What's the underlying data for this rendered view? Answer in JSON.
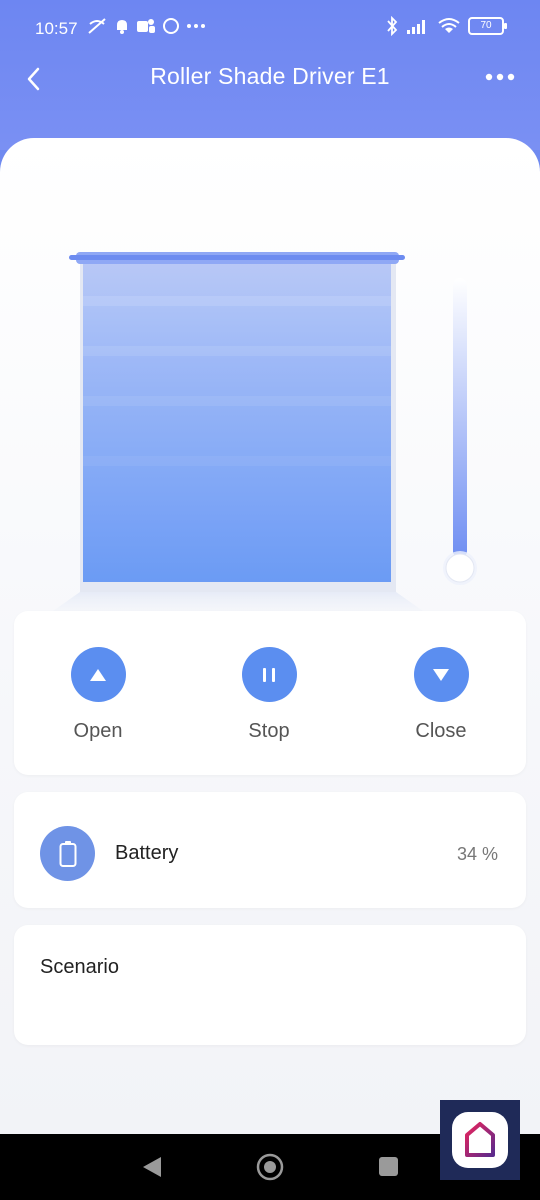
{
  "status": {
    "time": "10:57",
    "battery": "70"
  },
  "app": {
    "title": "Roller Shade Driver E1"
  },
  "shade": {
    "position_percent": 0
  },
  "controls": {
    "open": "Open",
    "stop": "Stop",
    "close": "Close"
  },
  "battery": {
    "label": "Battery",
    "value": "34 %"
  },
  "scenario": {
    "label": "Scenario"
  },
  "colors": {
    "accent": "#5b8ef0",
    "header": "#6f8af0"
  },
  "icons": [
    "back-arrow-icon",
    "more-dots-icon",
    "open-arrow-icon",
    "pause-icon",
    "close-arrow-icon",
    "battery-icon",
    "home-icon"
  ]
}
